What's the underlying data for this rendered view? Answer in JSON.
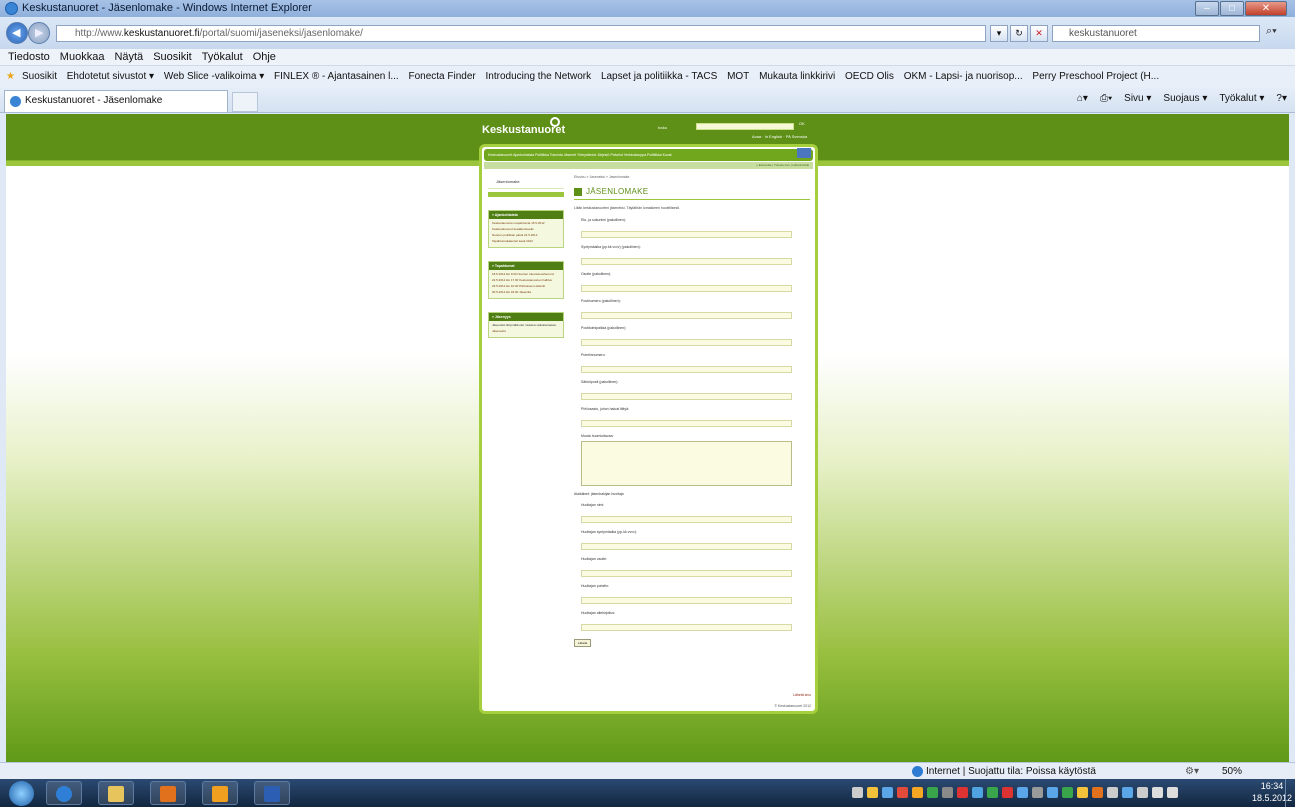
{
  "window": {
    "title": "Keskustanuoret - Jäsenlomake - Windows Internet Explorer"
  },
  "address": {
    "url_prefix": "http://www.",
    "url_domain": "keskustanuoret.fi",
    "url_path": "/portal/suomi/jaseneksi/jasenlomake/",
    "search_value": "keskustanuoret"
  },
  "menu": [
    "Tiedosto",
    "Muokkaa",
    "Näytä",
    "Suosikit",
    "Työkalut",
    "Ohje"
  ],
  "favorites": {
    "label": "Suosikit",
    "items": [
      "Ehdotetut sivustot ▾",
      "Web Slice -valikoima ▾",
      "FINLEX ® - Ajantasainen l...",
      "Fonecta Finder",
      "Introducing the Network",
      "Lapset ja politiikka - TACS",
      "MOT",
      "Mukauta linkkirivi",
      "OECD Olis",
      "OKM - Lapsi- ja nuorisop...",
      "Perry Preschool Project (H..."
    ]
  },
  "tab": {
    "label": "Keskustanuoret - Jäsenlomake"
  },
  "commandbar": [
    "Sivu ▾",
    "Suojaus ▾",
    "Työkalut ▾"
  ],
  "site": {
    "logo": "Keskustanuoret",
    "search_label": "haku",
    "search_go": "OK",
    "header_links": "Avaa · In English · På Svenska",
    "mainnav": "Keskustanuoret   Ajankohtaista   Politiikka   Toiminta   Jäsenet   Yhteystiedot   Järjestö   Palvelut   Verkkokauppa   Poliitiikka   Kuvat",
    "subnav": "« Etusivulle  |  Tulosta sivu  |  Lähetä linkki",
    "sidebar_top": "Jäsenlomake",
    "sidebar_box1_title": "» Ajankohtaista",
    "sidebar_box1_items": [
      "Keskustanuorten tapahtumat 15.5.2012",
      "Keskustanuoret kesäkiertueelle",
      "Nuorten politiikan päivä 24.5.2012",
      "Tapahtumakalenteri kesä 2012"
    ],
    "sidebar_box2_title": "» Tapahtumat",
    "sidebar_box2_items": [
      "18.5.2012 klo 9.00 Nuorten tulevaisuusfoorumi",
      "22.5.2012 klo 17.00 Keskustanuorten hallitus",
      "26.5.2012 klo 10.00 Piirikokous Helsinki",
      "30.5.2012 klo 18.00 Jäsenilta"
    ],
    "sidebar_box3_title": "» Jäsenyys",
    "sidebar_box3_text": "Jäseneksi liittymällä olet mukana vaikuttamassa.",
    "sidebar_box3_link": "Jäsenedut",
    "breadcrumb": "Etusivu » Jaseneksi » Jasenlomake",
    "page_title": "JÄSENLOMAKE",
    "intro": "Liitän keskustanuorten jäseneksi. Täytäthän lomakkeen huolellisesti.",
    "fields": [
      "Etu- ja sukunimi (pakollinen):",
      "Syntymäaika (pp.kk.vvvv) (pakollinen):",
      "Osoite (pakollinen):",
      "Postinumero (pakollinen):",
      "Postitoimipaikka (pakollinen):",
      "Puhelinnumero:",
      "Sähköposti (pakollinen):",
      "Piiri/osasto, johon haluat liittyä:"
    ],
    "textarea_label": "Muuta huomioitavaa:",
    "guardian_heading": "Alaikäiset: jäsenhakijan huoltaja",
    "guardian_fields": [
      "Huoltajan nimi:",
      "Huoltajan syntymäaika (pp.kk.vvvv):",
      "Huoltajan osoite:",
      "Huoltajan puhelin:",
      "Huoltajan allekirjoitus:"
    ],
    "submit": "Lähetä",
    "footer_link": "Lähetä sivu",
    "copyright": "© Keskustanuoret 2012"
  },
  "status": {
    "zone": "Internet | Suojattu tila: Poissa käytöstä",
    "zoom": "50%"
  },
  "taskbar": {
    "time": "16:34",
    "date": "18.5.2012"
  },
  "colors": {
    "site_green_dark": "#5e8f17",
    "site_green_light": "#9bc53d",
    "ie_blue": "#2d7bd2"
  }
}
